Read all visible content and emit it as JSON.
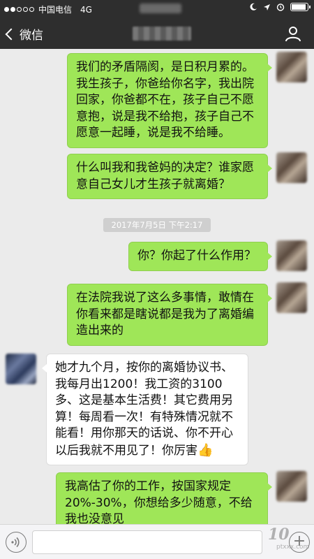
{
  "status_bar": {
    "carrier": "中国电信",
    "network": "4G"
  },
  "nav": {
    "back_label": "微信"
  },
  "messages": [
    {
      "side": "right",
      "text": "我们的矛盾隔阂，是日积月累的。我生孩子，你爸给你名字，我出院回家，你爸都不在，孩子自己不愿意抱，说是我不给抱，孩子自己不愿意一起睡，说是我不给睡。"
    },
    {
      "side": "right",
      "text": "什么叫我和我爸妈的决定？谁家愿意自己女儿才生孩子就离婚？"
    },
    {
      "side": "right",
      "text": "你？你起了什么作用？"
    },
    {
      "side": "right",
      "text": "在法院我说了这么多事情，敢情在你看来都是瞎说都是我为了离婚编造出来的"
    },
    {
      "side": "left",
      "text": "她才九个月，按你的离婚协议书、我每月出1200！我工资的3100多、这是基本生活费！其它费用另算！每周看一次！有特殊情况就不能看！用你那天的话说、你不开心以后我就不用见了！你厉害",
      "emoji": "👍"
    },
    {
      "side": "right",
      "text": "我高估了你的工作，按国家规定20%-30%，你想给多少随意，不给我也没意见"
    }
  ],
  "timestamp": "2017年7月5日 下午2:17",
  "watermark": {
    "logo": "10",
    "sub": "ptxxx.com"
  }
}
